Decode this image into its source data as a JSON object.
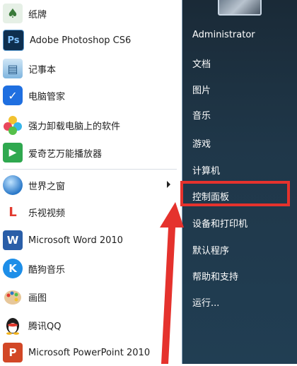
{
  "programs": [
    {
      "label": "纸牌",
      "icon": "solitaire-icon",
      "color": "#3a7a3a"
    },
    {
      "label": "Adobe Photoshop CS6",
      "icon": "photoshop-icon",
      "color": "#1b4c78",
      "text": "Ps"
    },
    {
      "label": "记事本",
      "icon": "notepad-icon",
      "color": "#5aa7d8"
    },
    {
      "label": "电脑管家",
      "icon": "pc-manager-icon",
      "color": "#1f6fe0"
    },
    {
      "label": "强力卸载电脑上的软件",
      "icon": "uninstaller-icon",
      "color": "#e8b62c"
    },
    {
      "label": "爱奇艺万能播放器",
      "icon": "iqiyi-player-icon",
      "color": "#2fa84f"
    },
    {
      "label": "世界之窗",
      "icon": "theworld-browser-icon",
      "color": "#2a78c8"
    },
    {
      "label": "乐视视频",
      "icon": "letv-icon",
      "color": "#e23a2f",
      "text": "L"
    },
    {
      "label": "Microsoft Word 2010",
      "icon": "word-icon",
      "color": "#2a5ea8",
      "text": "W"
    },
    {
      "label": "酷狗音乐",
      "icon": "kugou-icon",
      "color": "#1d8ee8",
      "text": "K"
    },
    {
      "label": "画图",
      "icon": "paint-icon",
      "color": "#d98a3a"
    },
    {
      "label": "腾讯QQ",
      "icon": "qq-icon",
      "color": "#222222"
    },
    {
      "label": "Microsoft PowerPoint 2010",
      "icon": "powerpoint-icon",
      "color": "#d24726",
      "text": "P"
    }
  ],
  "right_items": [
    "Administrator",
    "文档",
    "图片",
    "音乐",
    "游戏",
    "计算机",
    "控制面板",
    "设备和打印机",
    "默认程序",
    "帮助和支持",
    "运行..."
  ],
  "highlighted_item": "控制面板",
  "annotation_color": "#e5322d"
}
